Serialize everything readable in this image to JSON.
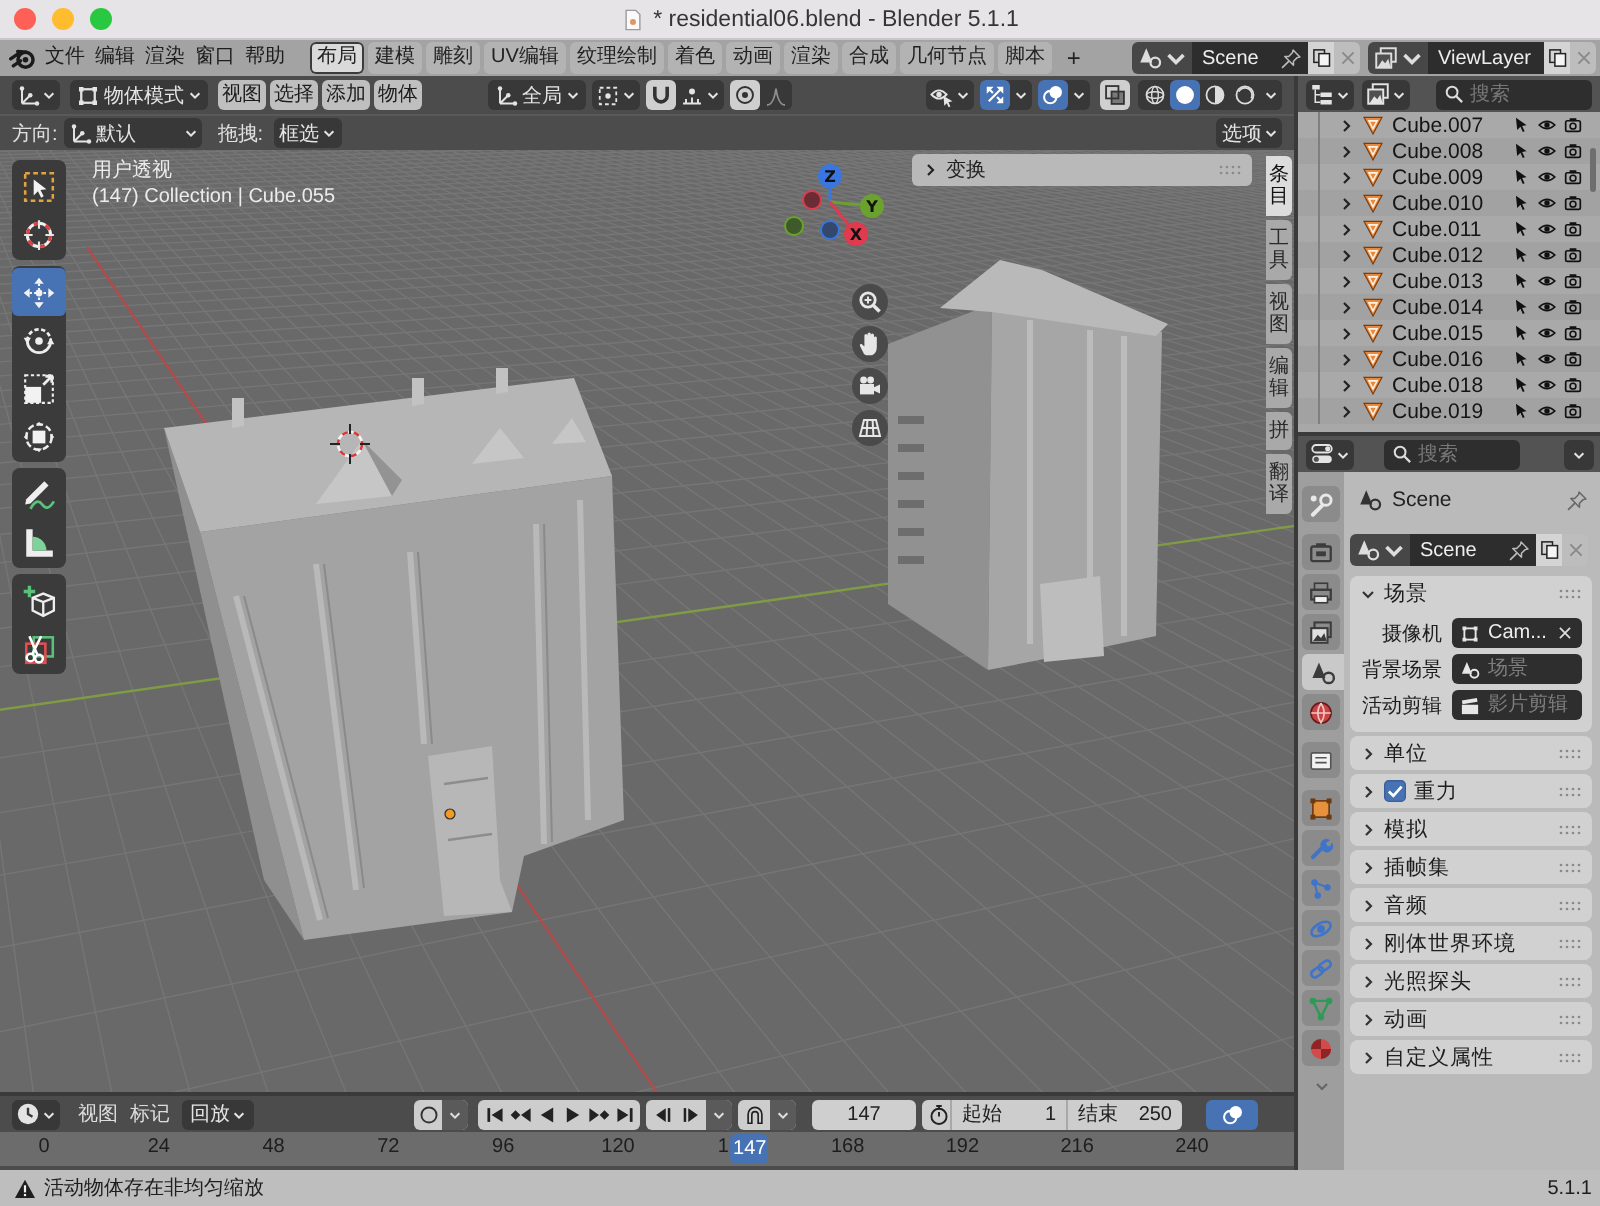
{
  "window": {
    "title": "* residential06.blend - Blender 5.1.1"
  },
  "menu": [
    "文件",
    "编辑",
    "渲染",
    "窗口",
    "帮助"
  ],
  "workspaces": [
    {
      "label": "布局",
      "selected": true
    },
    {
      "label": "建模",
      "selected": false
    },
    {
      "label": "雕刻",
      "selected": false
    },
    {
      "label": "UV编辑",
      "selected": false
    },
    {
      "label": "纹理绘制",
      "selected": false
    },
    {
      "label": "着色",
      "selected": false
    },
    {
      "label": "动画",
      "selected": false
    },
    {
      "label": "渲染",
      "selected": false
    },
    {
      "label": "合成",
      "selected": false
    },
    {
      "label": "几何节点",
      "selected": false
    },
    {
      "label": "脚本",
      "selected": false
    }
  ],
  "add_workspace": "+",
  "scene_selector": {
    "value": "Scene"
  },
  "view_layer_selector": {
    "value": "ViewLayer"
  },
  "viewport": {
    "mode": "物体模式",
    "menus": [
      "视图",
      "选择",
      "添加",
      "物体"
    ],
    "orientation": "全局",
    "snap": {
      "on": false
    },
    "proportional": {
      "on": false
    },
    "gizmos": {
      "on": true
    },
    "overlays": {
      "on": true
    },
    "xray": {
      "on": false
    },
    "shading": [
      {
        "kind": "wireframe",
        "selected": false
      },
      {
        "kind": "solid",
        "selected": true
      },
      {
        "kind": "material",
        "selected": false
      },
      {
        "kind": "rendered",
        "selected": false
      }
    ],
    "tool_settings": {
      "orientation_label": "方向:",
      "orientation": "默认",
      "drag_label": "拖拽:",
      "drag": "框选",
      "options": "选项"
    },
    "view_name": "用户透视",
    "info": "(147) Collection | Cube.055",
    "tool_groups": [
      [
        {
          "kind": "select_box",
          "selected": false
        },
        {
          "kind": "cursor",
          "selected": false
        }
      ],
      [
        {
          "kind": "move",
          "selected": true
        },
        {
          "kind": "rotate",
          "selected": false
        },
        {
          "kind": "scale",
          "selected": false
        },
        {
          "kind": "transform",
          "selected": false
        }
      ],
      [
        {
          "kind": "annotate",
          "selected": false
        },
        {
          "kind": "measure",
          "selected": false
        }
      ],
      [
        {
          "kind": "add_cube",
          "selected": false
        },
        {
          "kind": "cut",
          "selected": false
        }
      ]
    ],
    "axes": [
      {
        "label": "Z",
        "color": "#3a76e0"
      },
      {
        "label": "Y",
        "color": "#6ba12d"
      },
      {
        "label": "X",
        "color": "#df3a4e"
      }
    ],
    "nav_buttons": [
      {
        "kind": "zoom"
      },
      {
        "kind": "pan"
      },
      {
        "kind": "camera"
      },
      {
        "kind": "perspective"
      }
    ],
    "sidebar": {
      "panel": {
        "label": "变换",
        "expanded": false
      },
      "tabs": [
        {
          "label": "条目",
          "selected": true
        },
        {
          "label": "工具",
          "selected": false
        },
        {
          "label": "视图",
          "selected": false
        },
        {
          "label": "编辑",
          "selected": false
        },
        {
          "label": "拼",
          "selected": false
        },
        {
          "label": "翻译",
          "selected": false
        }
      ]
    }
  },
  "outliner": {
    "search": {
      "placeholder": "搜索"
    },
    "items": [
      {
        "name": "Cube.007",
        "expanded": false
      },
      {
        "name": "Cube.008",
        "expanded": false
      },
      {
        "name": "Cube.009",
        "expanded": false
      },
      {
        "name": "Cube.010",
        "expanded": false
      },
      {
        "name": "Cube.011",
        "expanded": false
      },
      {
        "name": "Cube.012",
        "expanded": false
      },
      {
        "name": "Cube.013",
        "expanded": false
      },
      {
        "name": "Cube.014",
        "expanded": false
      },
      {
        "name": "Cube.015",
        "expanded": false
      },
      {
        "name": "Cube.016",
        "expanded": false
      },
      {
        "name": "Cube.018",
        "expanded": false
      },
      {
        "name": "Cube.019",
        "expanded": false
      }
    ]
  },
  "properties": {
    "search": {
      "placeholder": "搜索"
    },
    "tab_groups": [
      [
        {
          "kind": "tool",
          "selected": false
        }
      ],
      [
        {
          "kind": "render",
          "selected": false
        },
        {
          "kind": "output",
          "selected": false
        },
        {
          "kind": "view_layer",
          "selected": false
        },
        {
          "kind": "scene",
          "selected": true
        },
        {
          "kind": "world",
          "selected": false
        }
      ],
      [
        {
          "kind": "collection",
          "selected": false
        }
      ],
      [
        {
          "kind": "object",
          "selected": false
        },
        {
          "kind": "modifiers",
          "selected": false
        },
        {
          "kind": "particles",
          "selected": false
        },
        {
          "kind": "physics",
          "selected": false
        },
        {
          "kind": "constraints",
          "selected": false
        },
        {
          "kind": "data",
          "selected": false
        },
        {
          "kind": "material",
          "selected": false
        }
      ]
    ],
    "context": "Scene",
    "scene_selector": {
      "value": "Scene"
    },
    "panels": [
      {
        "label": "场景",
        "kind": "plain",
        "expanded": true,
        "fields": [
          {
            "label": "摄像机",
            "kind": "camera",
            "value": "Cam..."
          },
          {
            "label": "背景场景",
            "kind": "scene",
            "placeholder": "场景"
          },
          {
            "label": "活动剪辑",
            "kind": "clip",
            "placeholder": "影片剪辑"
          }
        ]
      },
      {
        "label": "单位",
        "kind": "plain",
        "expanded": false
      },
      {
        "label": "重力",
        "kind": "toggle",
        "expanded": false,
        "checked": true
      },
      {
        "label": "模拟",
        "kind": "plain",
        "expanded": false
      },
      {
        "label": "插帧集",
        "kind": "plain",
        "expanded": false
      },
      {
        "label": "音频",
        "kind": "plain",
        "expanded": false
      },
      {
        "label": "刚体世界环境",
        "kind": "plain",
        "expanded": false
      },
      {
        "label": "光照探头",
        "kind": "plain",
        "expanded": false
      },
      {
        "label": "动画",
        "kind": "plain",
        "expanded": false
      },
      {
        "label": "自定义属性",
        "kind": "plain",
        "expanded": false
      }
    ]
  },
  "timeline": {
    "menus": [
      "视图",
      "标记"
    ],
    "playback": "回放",
    "record": {
      "on": false
    },
    "current_frame": "147",
    "start_label": "起始",
    "start": "1",
    "end_label": "结束",
    "end": "250",
    "ruler": [
      {
        "kind": "tick",
        "label": "0"
      },
      {
        "kind": "tick",
        "label": "24"
      },
      {
        "kind": "tick",
        "label": "48"
      },
      {
        "kind": "tick",
        "label": "72"
      },
      {
        "kind": "tick",
        "label": "96"
      },
      {
        "kind": "tick",
        "label": "120"
      },
      {
        "kind": "tick",
        "label": "1"
      },
      {
        "kind": "playhead",
        "label": "147"
      },
      {
        "kind": "tick",
        "label": "168"
      },
      {
        "kind": "tick",
        "label": "192"
      },
      {
        "kind": "tick",
        "label": "216"
      },
      {
        "kind": "tick",
        "label": "240"
      }
    ]
  },
  "status_bar": {
    "message": "活动物体存在非均匀缩放",
    "version": "5.1.1"
  }
}
